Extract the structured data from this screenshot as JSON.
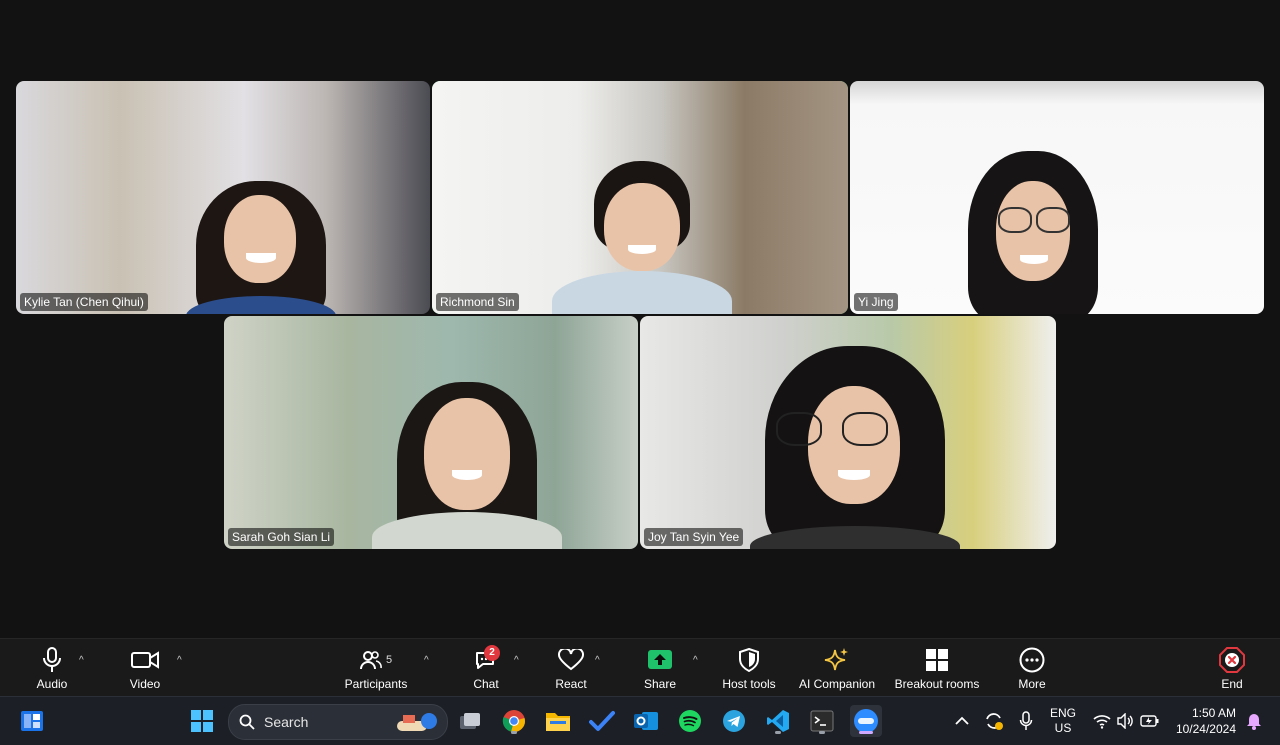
{
  "participants": [
    {
      "name": "Kylie Tan (Chen Qihui)",
      "active": false
    },
    {
      "name": "Richmond Sin",
      "active": true
    },
    {
      "name": "Yi Jing",
      "active": false
    },
    {
      "name": "Sarah Goh Sian Li",
      "active": false
    },
    {
      "name": "Joy Tan Syin Yee",
      "active": false
    }
  ],
  "toolbar": {
    "audio": "Audio",
    "video": "Video",
    "participants": "Participants",
    "participants_count": "5",
    "chat": "Chat",
    "chat_badge": "2",
    "react": "React",
    "share": "Share",
    "host_tools": "Host tools",
    "ai_companion": "AI Companion",
    "breakout_rooms": "Breakout rooms",
    "more": "More",
    "end": "End"
  },
  "taskbar": {
    "search_placeholder": "Search",
    "lang_line1": "ENG",
    "lang_line2": "US",
    "time": "1:50 AM",
    "date": "10/24/2024"
  },
  "colors": {
    "active_speaker": "#27c46b",
    "share_green": "#1fc26b",
    "end_red": "#e0383e",
    "chat_badge": "#e0383e"
  }
}
